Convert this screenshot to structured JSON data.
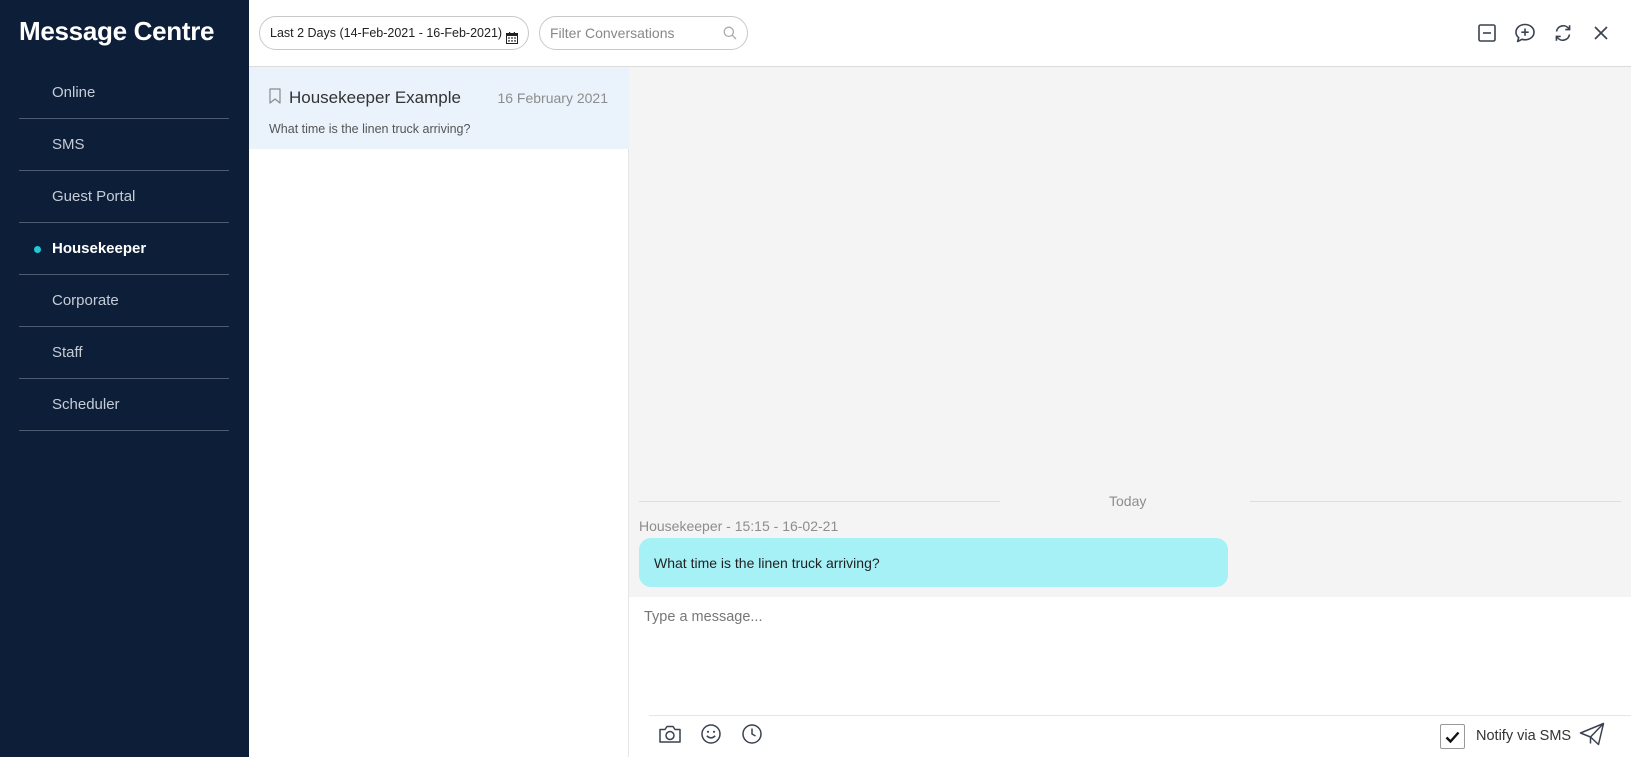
{
  "app": {
    "title": "Message Centre"
  },
  "sidebar": {
    "items": [
      {
        "label": "Online",
        "active": false
      },
      {
        "label": "SMS",
        "active": false
      },
      {
        "label": "Guest Portal",
        "active": false
      },
      {
        "label": "Housekeeper",
        "active": true
      },
      {
        "label": "Corporate",
        "active": false
      },
      {
        "label": "Staff",
        "active": false
      },
      {
        "label": "Scheduler",
        "active": false
      }
    ]
  },
  "toolbar": {
    "date_range": "Last 2 Days (14-Feb-2021 - 16-Feb-2021)",
    "filter_placeholder": "Filter Conversations",
    "icons": [
      "minimize-icon",
      "new-message-icon",
      "refresh-icon",
      "close-icon"
    ]
  },
  "conversations": [
    {
      "title": "Housekeeper Example",
      "date": "16 February 2021",
      "preview": "What time is the linen truck arriving?"
    }
  ],
  "thread": {
    "day_label": "Today",
    "messages": [
      {
        "meta": "Housekeeper - 15:15 - 16-02-21",
        "text": "What time is the linen truck arriving?"
      }
    ]
  },
  "composer": {
    "placeholder": "Type a message...",
    "notify_label": "Notify via SMS",
    "notify_checked": true
  },
  "colors": {
    "sidebar_bg": "#0d1e38",
    "accent_dot": "#21c8d8",
    "bubble": "#a6f1f6",
    "selected_row": "#eaf3fc"
  }
}
